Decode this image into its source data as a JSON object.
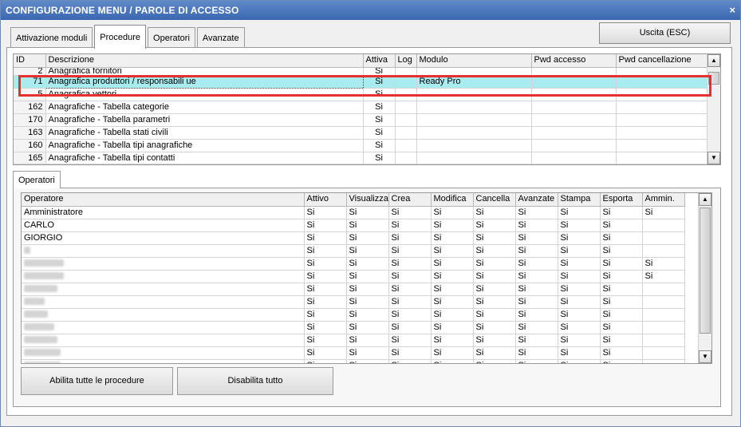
{
  "window": {
    "title": "CONFIGURAZIONE MENU / PAROLE DI ACCESSO",
    "close": "×"
  },
  "tabs": [
    "Attivazione moduli",
    "Procedure",
    "Operatori",
    "Avanzate"
  ],
  "exit_button": "Uscita (ESC)",
  "procedures": {
    "columns": [
      "ID",
      "Descrizione",
      "Attiva",
      "Log",
      "Modulo",
      "Pwd accesso",
      "Pwd cancellazione"
    ],
    "rows": [
      {
        "id": "2",
        "desc": "Anagrafica fornitori",
        "attiva": "Si",
        "log": "",
        "modulo": ""
      },
      {
        "id": "71",
        "desc": "Anagrafica produttori / responsabili ue",
        "attiva": "Si",
        "log": "",
        "modulo": "Ready Pro"
      },
      {
        "id": "5",
        "desc": "Anagrafica vettori",
        "attiva": "Si",
        "log": "",
        "modulo": ""
      },
      {
        "id": "162",
        "desc": "Anagrafiche - Tabella categorie",
        "attiva": "Si",
        "log": "",
        "modulo": ""
      },
      {
        "id": "170",
        "desc": "Anagrafiche - Tabella parametri",
        "attiva": "Si",
        "log": "",
        "modulo": ""
      },
      {
        "id": "163",
        "desc": "Anagrafiche - Tabella stati civili",
        "attiva": "Si",
        "log": "",
        "modulo": ""
      },
      {
        "id": "160",
        "desc": "Anagrafiche - Tabella tipi anagrafiche",
        "attiva": "Si",
        "log": "",
        "modulo": ""
      },
      {
        "id": "165",
        "desc": "Anagrafiche - Tabella tipi contatti",
        "attiva": "Si",
        "log": "",
        "modulo": ""
      }
    ]
  },
  "operators_tab": "Operatori",
  "operators": {
    "columns": [
      "Operatore",
      "Attivo",
      "Visualizza",
      "Crea",
      "Modifica",
      "Cancella",
      "Avanzate",
      "Stampa",
      "Esporta",
      "Ammin."
    ],
    "rows": [
      {
        "name": "Amministratore",
        "vals": [
          "Si",
          "Si",
          "Si",
          "Si",
          "Si",
          "Si",
          "Si",
          "Si",
          "Si"
        ]
      },
      {
        "name": "CARLO",
        "vals": [
          "Si",
          "Si",
          "Si",
          "Si",
          "Si",
          "Si",
          "Si",
          "Si",
          ""
        ]
      },
      {
        "name": "GIORGIO",
        "vals": [
          "Si",
          "Si",
          "Si",
          "Si",
          "Si",
          "Si",
          "Si",
          "Si",
          ""
        ]
      },
      {
        "name": "",
        "vals": [
          "Si",
          "Si",
          "Si",
          "Si",
          "Si",
          "Si",
          "Si",
          "Si",
          ""
        ]
      },
      {
        "name": "",
        "vals": [
          "Si",
          "Si",
          "Si",
          "Si",
          "Si",
          "Si",
          "Si",
          "Si",
          "Si"
        ]
      },
      {
        "name": "",
        "vals": [
          "Si",
          "Si",
          "Si",
          "Si",
          "Si",
          "Si",
          "Si",
          "Si",
          "Si"
        ]
      },
      {
        "name": "",
        "vals": [
          "Si",
          "Si",
          "Si",
          "Si",
          "Si",
          "Si",
          "Si",
          "Si",
          ""
        ]
      },
      {
        "name": "",
        "vals": [
          "Si",
          "Si",
          "Si",
          "Si",
          "Si",
          "Si",
          "Si",
          "Si",
          ""
        ]
      },
      {
        "name": "",
        "vals": [
          "Si",
          "Si",
          "Si",
          "Si",
          "Si",
          "Si",
          "Si",
          "Si",
          ""
        ]
      },
      {
        "name": "",
        "vals": [
          "Si",
          "Si",
          "Si",
          "Si",
          "Si",
          "Si",
          "Si",
          "Si",
          ""
        ]
      },
      {
        "name": "",
        "vals": [
          "Si",
          "Si",
          "Si",
          "Si",
          "Si",
          "Si",
          "Si",
          "Si",
          ""
        ]
      },
      {
        "name": "",
        "vals": [
          "Si",
          "Si",
          "Si",
          "Si",
          "Si",
          "Si",
          "Si",
          "Si",
          ""
        ]
      },
      {
        "name": "",
        "vals": [
          "Si",
          "Si",
          "Si",
          "Si",
          "Si",
          "Si",
          "Si",
          "Si",
          ""
        ]
      }
    ]
  },
  "buttons": {
    "enable_all": "Abilita tutte le procedure",
    "disable_all": "Disabilita tutto"
  },
  "icons": {
    "scroll_up": "▲",
    "scroll_down": "▼"
  },
  "colors": {
    "selected_row": "#a8ecf0",
    "highlight_box": "#e83030",
    "titlebar": "#4a76bd"
  }
}
